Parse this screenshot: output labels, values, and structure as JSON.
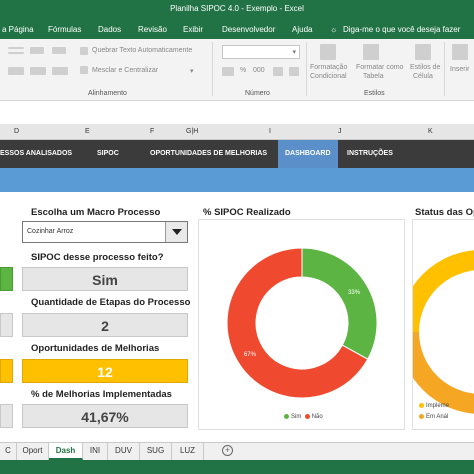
{
  "window": {
    "title": "Planilha SIPOC 4.0 - Exemplo  -  Excel"
  },
  "menu": [
    "a Página",
    "Fórmulas",
    "Dados",
    "Revisão",
    "Exibir",
    "Desenvolvedor",
    "Ajuda",
    "Diga-me o que você deseja fazer"
  ],
  "ribbon": {
    "wrap_text": "Quebrar Texto Automaticamente",
    "merge_center": "Mesclar e Centralizar",
    "group_alignment": "Alinhamento",
    "group_number": "Número",
    "cond_format": [
      "Formatação",
      "Condicional"
    ],
    "format_table": [
      "Formatar como",
      "Tabela"
    ],
    "cell_styles": [
      "Estilos de",
      "Célula"
    ],
    "group_styles": "Estilos",
    "insert": "Inserir",
    "number_symbols": [
      "%",
      "000"
    ]
  },
  "columns": [
    "D",
    "E",
    "F",
    "G|H",
    "I",
    "J",
    "K"
  ],
  "nav": {
    "items": [
      "ESSOS ANALISADOS",
      "SIPOC",
      "OPORTUNIDADES DE MELHORIAS",
      "DASHBOARD",
      "INSTRUÇÕES"
    ],
    "active": "DASHBOARD"
  },
  "dashboard": {
    "choose_label": "Escolha um Macro Processo",
    "selected_process": "Cozinhar Arroz",
    "sipoc_done_label": "SIPOC desse processo feito?",
    "sipoc_done_value": "Sim",
    "steps_label": "Quantidade de Etapas do Processo",
    "steps_value": "2",
    "opps_label": "Oportunidades de Melhorias",
    "opps_value": "12",
    "pct_impl_label": "% de Melhorias Implementadas",
    "pct_impl_value": "41,67%",
    "status_title": "Status das Op",
    "status_legend": [
      "Impleme",
      "Em Anál"
    ]
  },
  "chart_data": {
    "type": "pie",
    "title": "% SIPOC Realizado",
    "categories": [
      "Sim",
      "Não"
    ],
    "values": [
      33,
      67
    ],
    "labels": [
      "33%",
      "67%"
    ],
    "colors": [
      "#5cb543",
      "#ef4a2f"
    ],
    "legend": "bottom"
  },
  "sheet_tabs": [
    "C",
    "Oport",
    "Dash",
    "INI",
    "DUV",
    "SUG",
    "LUZ"
  ],
  "active_tab": "Dash",
  "colors": {
    "excel_green": "#217346",
    "nav_dark": "#3b3b3b",
    "nav_active": "#5b8fc9",
    "band_blue": "#5b9bd5",
    "yellow": "#ffc000",
    "status_orange": "#f5a623"
  }
}
